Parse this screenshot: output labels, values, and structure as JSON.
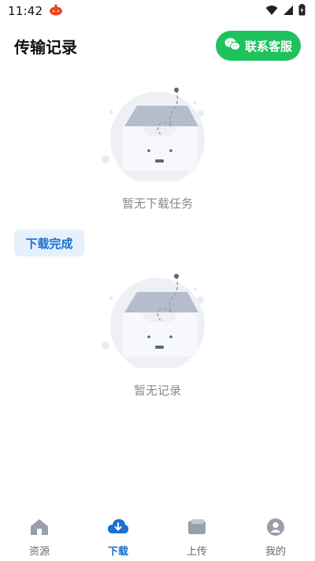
{
  "status_bar": {
    "time": "11:42"
  },
  "header": {
    "title": "传输记录",
    "contact_label": "联系客服"
  },
  "sections": {
    "downloading_empty": "暂无下载任务",
    "completed_chip": "下载完成",
    "completed_empty": "暂无记录"
  },
  "bottom_nav": {
    "items": [
      {
        "label": "资源",
        "icon": "home-icon"
      },
      {
        "label": "下载",
        "icon": "cloud-download-icon"
      },
      {
        "label": "上传",
        "icon": "folder-icon"
      },
      {
        "label": "我的",
        "icon": "profile-icon"
      }
    ],
    "active_index": 1
  },
  "colors": {
    "accent": "#1a6fd0",
    "contact_button": "#1fc25c",
    "chip_background": "#e6f1fd",
    "muted_text": "#8a8a8a"
  }
}
